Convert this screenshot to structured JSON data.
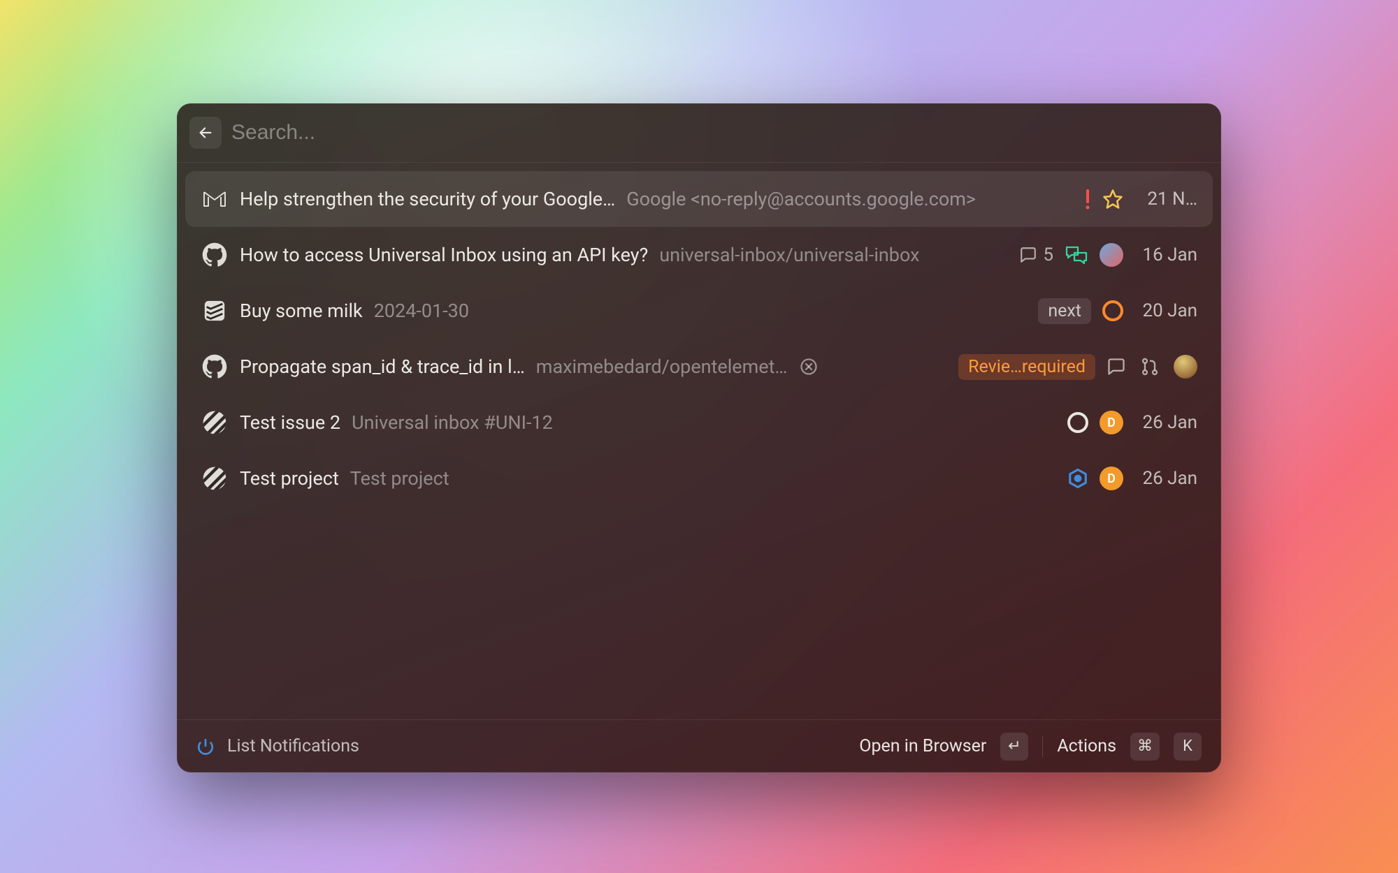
{
  "search": {
    "placeholder": "Search..."
  },
  "footer": {
    "left_label": "List Notifications",
    "open_label": "Open in Browser",
    "actions_label": "Actions",
    "enter_key": "↵",
    "cmd_key": "⌘",
    "k_key": "K"
  },
  "colors": {
    "accent_orange": "#ff9a3c",
    "star_gold": "#f6c750",
    "alert_red": "#ff4d4d",
    "discussion_green": "#37d39f",
    "hex_blue": "#3e8de0"
  },
  "rows": [
    {
      "source": "gmail",
      "title": "Help strengthen the security of your Google…",
      "subtitle": "Google <no-reply@accounts.google.com>",
      "date": "21 N…",
      "selected": true,
      "priority": true,
      "starred": true
    },
    {
      "source": "github",
      "title": "How to access Universal Inbox using an API key?",
      "subtitle": "universal-inbox/universal-inbox",
      "date": "16 Jan",
      "comments": "5",
      "discussion": true,
      "avatar_type": "pic"
    },
    {
      "source": "todoist",
      "title": "Buy some milk",
      "subtitle": "2024-01-30",
      "date": "20 Jan",
      "tag": "next",
      "ring": "orange"
    },
    {
      "source": "github",
      "title": "Propagate span_id & trace_id in l…",
      "subtitle": "maximebedard/opentelemet…",
      "closed": true,
      "tag_orange": "Revie…required",
      "comment_icon": true,
      "pr_icon": true,
      "avatar_type": "globe"
    },
    {
      "source": "linear",
      "title": "Test issue 2",
      "subtitle": "Universal inbox #UNI-12",
      "date": "26 Jan",
      "ring": "white",
      "avatar_type": "letter",
      "avatar_letter": "D"
    },
    {
      "source": "linear",
      "title": "Test project",
      "subtitle": "Test project",
      "date": "26 Jan",
      "hex": true,
      "avatar_type": "letter",
      "avatar_letter": "D"
    }
  ]
}
